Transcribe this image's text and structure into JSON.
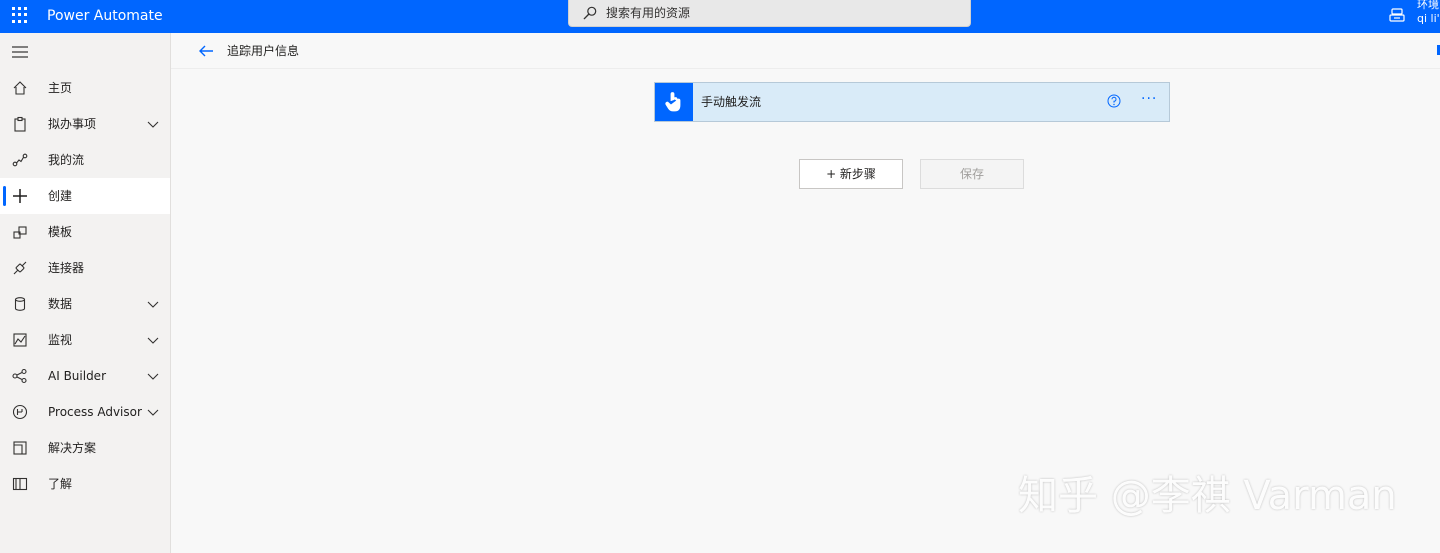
{
  "topbar": {
    "app_name": "Power Automate",
    "search_placeholder": "搜索有用的资源",
    "env_label": "环境",
    "env_name": "qi li's"
  },
  "sidebar": {
    "items": [
      {
        "label": "主页",
        "icon": "home-icon",
        "chevron": false,
        "active": false
      },
      {
        "label": "拟办事项",
        "icon": "clipboard-icon",
        "chevron": true,
        "active": false
      },
      {
        "label": "我的流",
        "icon": "flow-icon",
        "chevron": false,
        "active": false
      },
      {
        "label": "创建",
        "icon": "plus-icon",
        "chevron": false,
        "active": true
      },
      {
        "label": "模板",
        "icon": "template-icon",
        "chevron": false,
        "active": false
      },
      {
        "label": "连接器",
        "icon": "connector-icon",
        "chevron": false,
        "active": false
      },
      {
        "label": "数据",
        "icon": "database-icon",
        "chevron": true,
        "active": false
      },
      {
        "label": "监视",
        "icon": "monitor-icon",
        "chevron": true,
        "active": false
      },
      {
        "label": "AI Builder",
        "icon": "ai-builder-icon",
        "chevron": true,
        "active": false
      },
      {
        "label": "Process Advisor",
        "icon": "process-advisor-icon",
        "chevron": true,
        "active": false
      },
      {
        "label": "解决方案",
        "icon": "solutions-icon",
        "chevron": false,
        "active": false
      },
      {
        "label": "了解",
        "icon": "book-icon",
        "chevron": false,
        "active": false
      }
    ]
  },
  "main": {
    "flow_title": "追踪用户信息",
    "trigger_label": "手动触发流",
    "more_label": "···",
    "new_step_label": "+ 新步骤",
    "save_label": "保存"
  },
  "watermark": "知乎 @李祺 Varman",
  "colors": {
    "brand": "#0066ff",
    "trigger_bg": "#d9ebf8",
    "sidebar_bg": "#f3f2f1",
    "canvas_bg": "#f8f8f8"
  }
}
